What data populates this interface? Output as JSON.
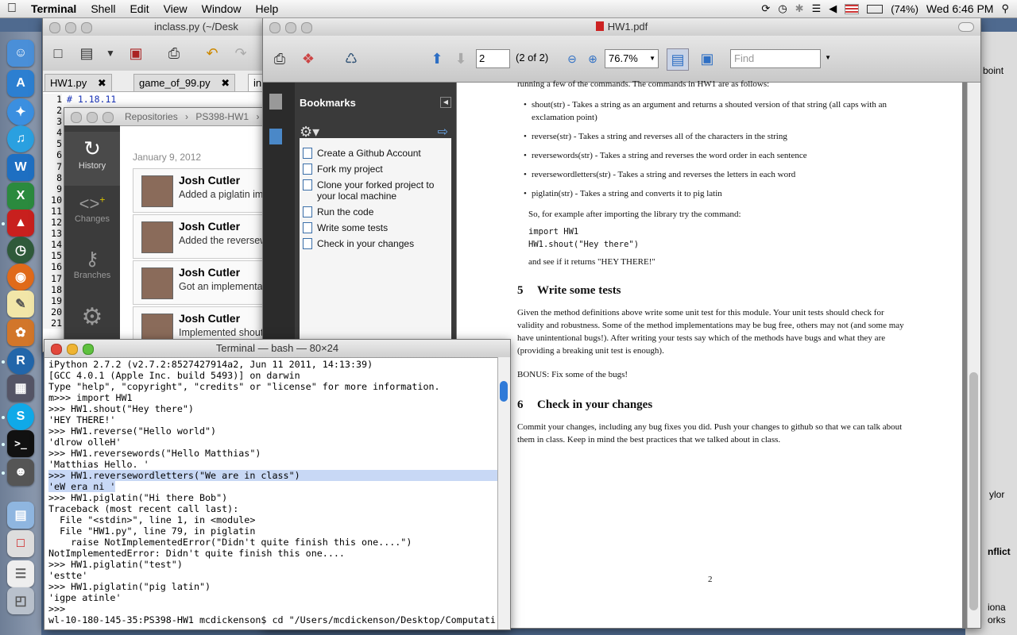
{
  "menubar": {
    "apple": "",
    "app": "Terminal",
    "items": [
      "Shell",
      "Edit",
      "View",
      "Window",
      "Help"
    ],
    "battery": "(74%)",
    "clock": "Wed 6:46 PM"
  },
  "editor": {
    "title": "inclass.py (~/Desk",
    "tabs": [
      "HW1.py",
      "game_of_99.py",
      "in"
    ],
    "line_numbers": [
      "1",
      "2",
      "3",
      "4",
      "5",
      "6",
      "7",
      "8",
      "9",
      "10",
      "11",
      "12",
      "13",
      "14",
      "15",
      "16",
      "17",
      "18",
      "19",
      "20",
      "21"
    ],
    "first_line": "# 1.18.11"
  },
  "github": {
    "breadcrumb": [
      "Repositories",
      "PS398-HW1"
    ],
    "nav": [
      "History",
      "Changes",
      "Branches"
    ],
    "date": "January 9, 2012",
    "commits": [
      {
        "author": "Josh Cutler",
        "message": "Added a piglatin im"
      },
      {
        "author": "Josh Cutler",
        "message": "Added the reversew"
      },
      {
        "author": "Josh Cutler",
        "message": "Got an implementat"
      },
      {
        "author": "Josh Cutler",
        "message": "Implemented shout"
      }
    ]
  },
  "pdf": {
    "title": "HW1.pdf",
    "page_input": "2",
    "page_of": "(2 of 2)",
    "zoom": "76.7%",
    "find_placeholder": "Find",
    "bookmarks_title": "Bookmarks",
    "bookmarks": [
      "Create a Github Account",
      "Fork my project",
      "Clone your forked project to your local machine",
      "Run the code",
      "Write some tests",
      "Check in your changes"
    ],
    "content": {
      "intro": "running a few of the commands. The commands in HW1 are as follows:",
      "bullets": [
        "shout(str) - Takes a string as an argument and returns a shouted version of that string (all caps with an exclamation point)",
        "reverse(str) - Takes a string and reverses all of the characters in the string",
        "reversewords(str) - Takes a string and reverses the word order in each sentence",
        "reversewordletters(str) - Takes a string and reverses the letters in each word",
        "piglatin(str) - Takes a string and converts it to pig latin"
      ],
      "example_intro": "So, for example after importing the library try the command:",
      "code1": "import HW1",
      "code2": "HW1.shout(\"Hey there\")",
      "example_after": "and see if it returns \"HEY THERE!\"",
      "s5_num": "5",
      "s5_title": "Write some tests",
      "s5_body": "Given the method definitions above write some unit test for this module. Your unit tests should check for validity and robustness. Some of the method implementations may be bug free, others may not (and some may have unintentional bugs!). After writing your tests say which of the methods have bugs and what they are (providing a breaking unit test is enough).",
      "bonus": "BONUS: Fix some of the bugs!",
      "s6_num": "6",
      "s6_title": "Check in your changes",
      "s6_body": "Commit your changes, including any bug fixes you did. Push your changes to github so that we can talk about them in class. Keep in mind the best practices that we talked about in class.",
      "page_number": "2"
    }
  },
  "terminal": {
    "title": "Terminal — bash — 80×24",
    "lines": [
      "iPython 2.7.2 (v2.7.2:8527427914a2, Jun 11 2011, 14:13:39)",
      "[GCC 4.0.1 (Apple Inc. build 5493)] on darwin",
      "Type \"help\", \"copyright\", \"credits\" or \"license\" for more information.",
      "m>>> import HW1",
      ">>> HW1.shout(\"Hey there\")",
      "'HEY THERE!'",
      ">>> HW1.reverse(\"Hello world\")",
      "'dlrow olleH'",
      ">>> HW1.reversewords(\"Hello Matthias\")",
      "'Matthias Hello. '",
      ">>> HW1.reversewordletters(\"We are in class\")",
      "'eW era ni '",
      ">>> HW1.piglatin(\"Hi there Bob\")",
      "Traceback (most recent call last):",
      "  File \"<stdin>\", line 1, in <module>",
      "  File \"HW1.py\", line 79, in piglatin",
      "    raise NotImplementedError(\"Didn't quite finish this one....\")",
      "NotImplementedError: Didn't quite finish this one....",
      ">>> HW1.piglatin(\"test\")",
      "'estte'",
      ">>> HW1.piglatin(\"pig latin\")",
      "'igpe atinle'",
      ">>>",
      "wl-10-180-145-35:PS398-HW1 mcdickenson$ cd \"/Users/mcdickenson/Desktop/Computati"
    ]
  },
  "right_window": {
    "snippets": [
      "boint",
      "ylor",
      "nflict",
      "iona",
      "orks"
    ]
  }
}
